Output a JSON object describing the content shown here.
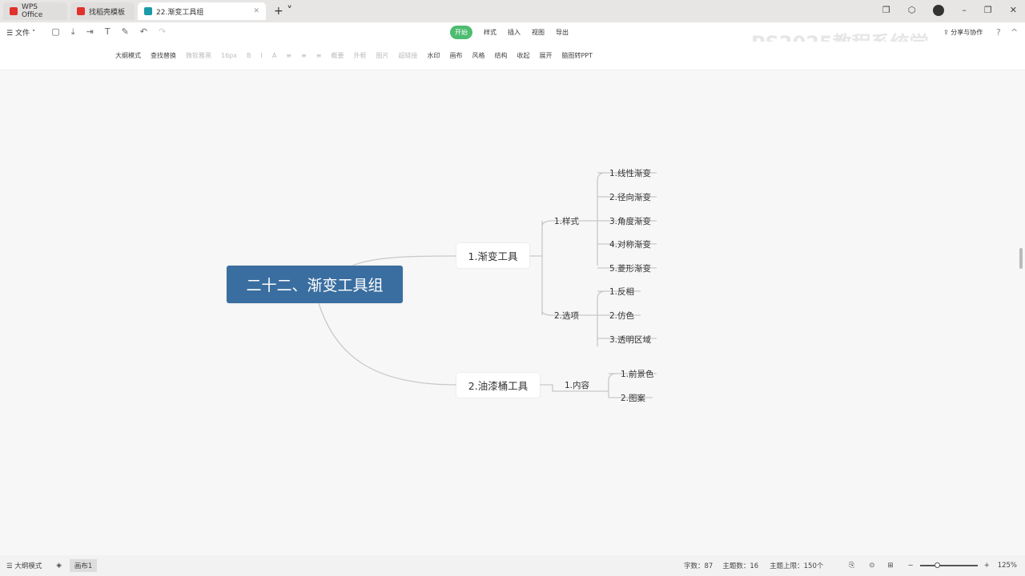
{
  "tabs": [
    {
      "label": "WPS Office",
      "color": "#e0312b"
    },
    {
      "label": "找稻壳模板",
      "color": "#e0312b"
    },
    {
      "label": "22.渐变工具组",
      "color": "#1c9aa8"
    }
  ],
  "toolbar": {
    "file": "文件",
    "menu": [
      "开始",
      "样式",
      "插入",
      "视图",
      "导出"
    ],
    "share": "分享与协作",
    "items": [
      {
        "label": "大纲模式",
        "on": true
      },
      {
        "label": "查找替换",
        "on": true
      },
      {
        "label": "微软雅黑",
        "on": false
      },
      {
        "label": "16px",
        "on": false
      },
      {
        "label": "B",
        "on": false
      },
      {
        "label": "I",
        "on": false
      },
      {
        "label": "A",
        "on": false
      },
      {
        "label": "≡",
        "on": false
      },
      {
        "label": "≡",
        "on": false
      },
      {
        "label": "≡",
        "on": false
      },
      {
        "label": "概要",
        "on": false
      },
      {
        "label": "外框",
        "on": false
      },
      {
        "label": "图片",
        "on": false
      },
      {
        "label": "超链接",
        "on": false
      },
      {
        "label": "水印",
        "on": true
      },
      {
        "label": "画布",
        "on": true
      },
      {
        "label": "风格",
        "on": true
      },
      {
        "label": "结构",
        "on": true
      },
      {
        "label": "收起",
        "on": true
      },
      {
        "label": "展开",
        "on": true
      },
      {
        "label": "脑图转PPT",
        "on": true
      }
    ]
  },
  "watermark": "PS2025教程系统学",
  "mindmap": {
    "root": "二十二、渐变工具组",
    "n1": "1.渐变工具",
    "n2": "2.油漆桶工具",
    "s1": "1.样式",
    "s2": "2.选项",
    "s3": "1.内容",
    "l1": [
      "1.线性渐变",
      "2.径向渐变",
      "3.角度渐变",
      "4.对称渐变",
      "5.菱形渐变"
    ],
    "l2": [
      "1.反相",
      "2.仿色",
      "3.透明区域"
    ],
    "l3": [
      "1.前景色",
      "2.图案"
    ]
  },
  "status": {
    "outline": "大纲模式",
    "canvas": "画布1",
    "words": "字数：87",
    "topics": "主题数：16",
    "limit": "主题上限：150个",
    "zoom": "125%",
    "accent": "#4cbc6f",
    "root_color": "#3a6ea0"
  }
}
